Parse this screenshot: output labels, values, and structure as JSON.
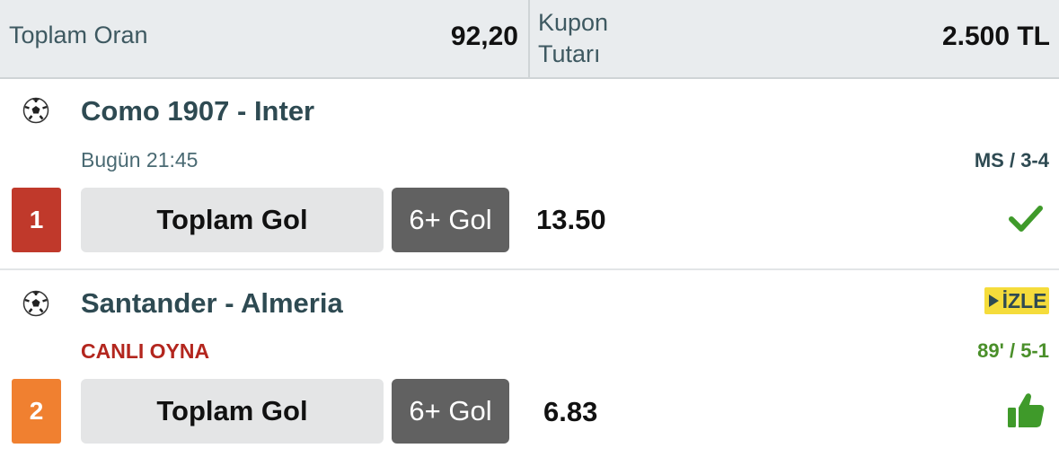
{
  "header": {
    "total_odds_label": "Toplam Oran",
    "total_odds_value": "92,20",
    "coupon_label": "Kupon Tutarı",
    "coupon_value": "2.500 TL"
  },
  "matches": [
    {
      "index": "1",
      "index_color": "#c0392b",
      "teams": "Como 1907 - Inter",
      "time": "Bugün 21:45",
      "meta": "MS / 3-4",
      "market": "Toplam Gol",
      "pick": "6+ Gol",
      "odd": "13.50",
      "status_icon": "check-icon",
      "status_color": "#3f9a2a"
    },
    {
      "index": "2",
      "index_color": "#f08030",
      "teams": "Santander - Almeria",
      "time": "CANLI OYNA",
      "meta": "89' / 5-1",
      "watch_label": "İZLE",
      "market": "Toplam Gol",
      "pick": "6+ Gol",
      "odd": "6.83",
      "status_icon": "thumbs-up-icon",
      "status_color": "#3f9a2a"
    }
  ]
}
